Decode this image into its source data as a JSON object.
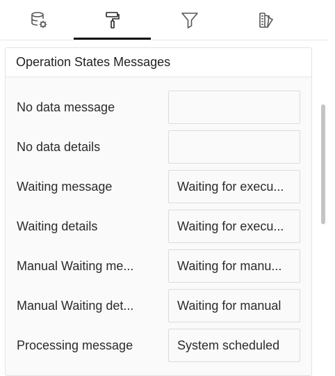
{
  "tabs": [
    {
      "name": "data-icon"
    },
    {
      "name": "format-paint-icon"
    },
    {
      "name": "filter-icon"
    },
    {
      "name": "theme-icon"
    }
  ],
  "panel": {
    "title": "Operation States Messages",
    "rows": [
      {
        "label": "No data message",
        "value": ""
      },
      {
        "label": "No data details",
        "value": ""
      },
      {
        "label": "Waiting message",
        "value": "Waiting for execu..."
      },
      {
        "label": "Waiting details",
        "value": "Waiting for execu..."
      },
      {
        "label": "Manual Waiting me...",
        "value": "Waiting for manu..."
      },
      {
        "label": "Manual Waiting det...",
        "value": "Waiting for manual"
      },
      {
        "label": "Processing message",
        "value": "System scheduled"
      }
    ]
  }
}
